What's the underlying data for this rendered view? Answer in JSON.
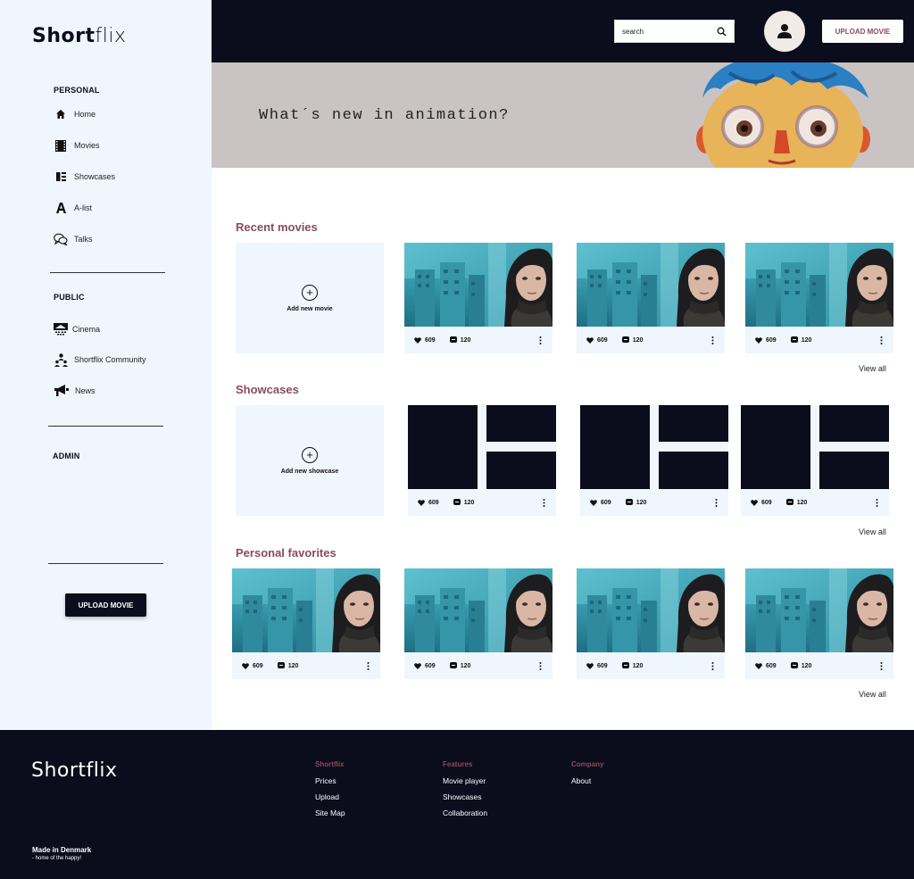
{
  "app": {
    "logo_light": "Short",
    "logo_bold": "flix"
  },
  "sidebar": {
    "personal_label": "PERSONAL",
    "personal_items": [
      {
        "label": "Home",
        "icon": "home-icon"
      },
      {
        "label": "Movies",
        "icon": "film-icon"
      },
      {
        "label": "Showcases",
        "icon": "showcase-icon"
      },
      {
        "label": "A-list",
        "icon": "a-list-icon"
      },
      {
        "label": "Talks",
        "icon": "chat-bubbles-icon"
      }
    ],
    "public_label": "PUBLIC",
    "public_items": [
      {
        "label": "Cinema",
        "icon": "cinema-screen-icon"
      },
      {
        "label": "Shortflix Community",
        "icon": "community-icon"
      },
      {
        "label": "News",
        "icon": "megaphone-icon"
      }
    ],
    "admin_label": "ADMIN",
    "upload_label": "UPLOAD MOVIE"
  },
  "header": {
    "search_value": "search",
    "upload_label": "UPLOAD MOVIE"
  },
  "banner": {
    "text": "What´s new in animation?"
  },
  "sections": {
    "recent": {
      "title": "Recent movies",
      "add_label": "Add new movie",
      "view_all": "View all"
    },
    "showcases": {
      "title": "Showcases",
      "add_label": "Add new showcase",
      "view_all": "View all"
    },
    "favorites": {
      "title": "Personal favorites",
      "view_all": "View all"
    }
  },
  "card_stats": {
    "likes": "609",
    "comments": "120"
  },
  "footer": {
    "logo": "Shortflix",
    "columns": [
      {
        "title": "Shortflix",
        "links": [
          "Prices",
          "Upload",
          "Site Map"
        ]
      },
      {
        "title": "Features",
        "links": [
          "Movie player",
          "Showcases",
          "Collaboration"
        ]
      },
      {
        "title": "Company",
        "links": [
          "About"
        ]
      }
    ],
    "made_in": "Made in Denmark",
    "made_sub": "- home of the happy!"
  },
  "colors": {
    "navy": "#0b0c1c",
    "accent": "#8a4b5c",
    "sidebar_bg": "#eff6fd",
    "banner_bg": "#c9c3c3"
  }
}
